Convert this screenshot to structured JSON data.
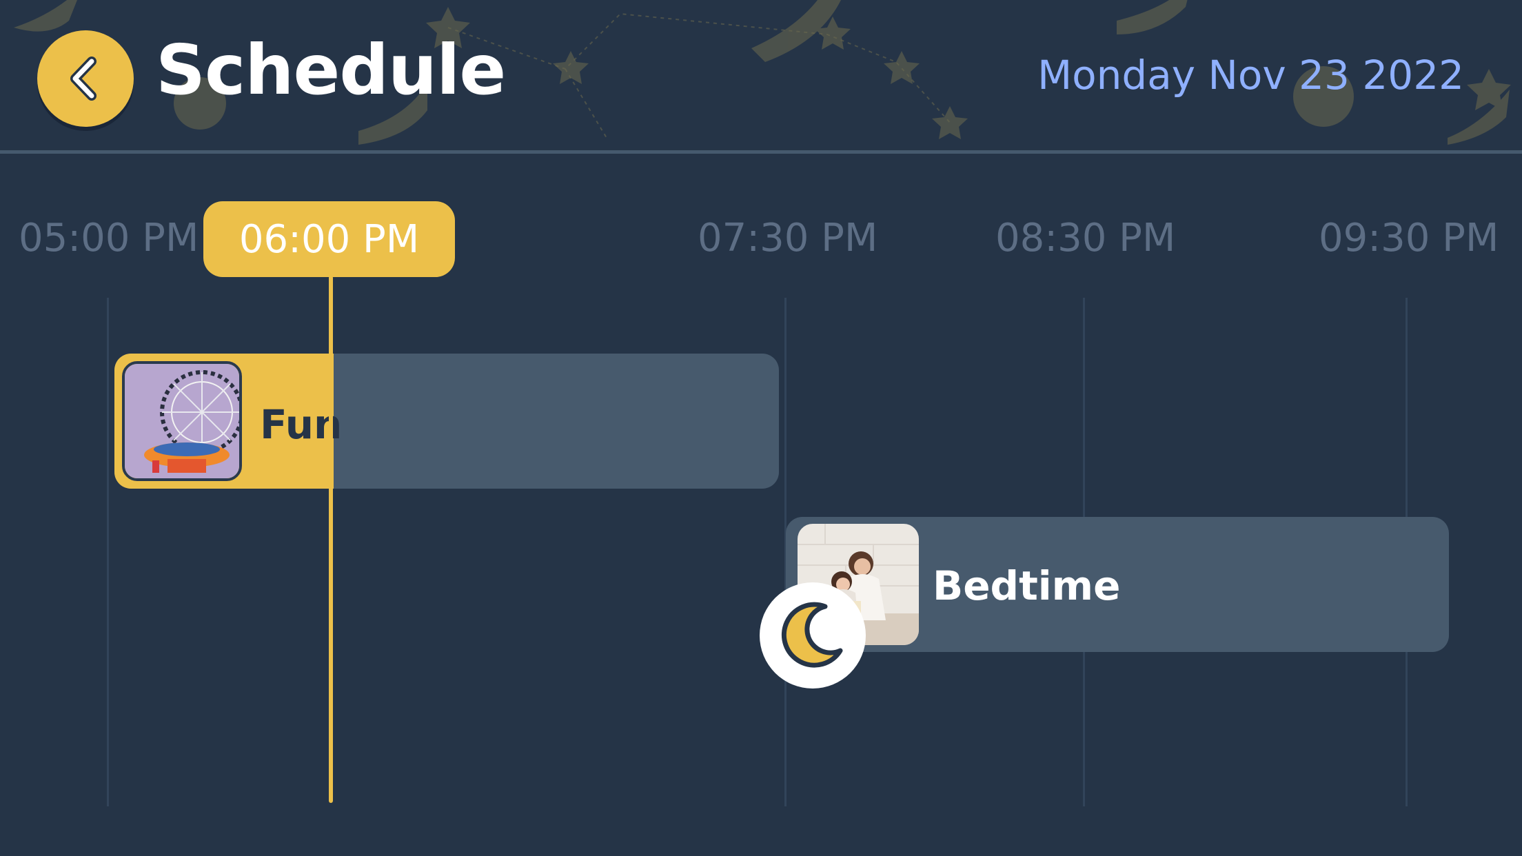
{
  "app": {
    "title": "Schedule",
    "date": "Monday Nov 23 2022",
    "back_icon": "chevron-left-icon"
  },
  "timeline": {
    "current_time": "06:00 PM",
    "labels": [
      "05:00 PM",
      "07:30 PM",
      "08:30 PM",
      "09:30 PM"
    ]
  },
  "events": [
    {
      "label": "Fun",
      "image": "ferris-wheel-photo",
      "progress_percent": 33
    },
    {
      "label": "Bedtime",
      "image": "mother-daughter-bed-photo",
      "badge_icon": "moon-icon"
    }
  ],
  "colors": {
    "background": "#253447",
    "accent": "#ecc04a",
    "card": "#475a6d",
    "date_text": "#8fb0ff",
    "muted_text": "#5d6e85"
  }
}
